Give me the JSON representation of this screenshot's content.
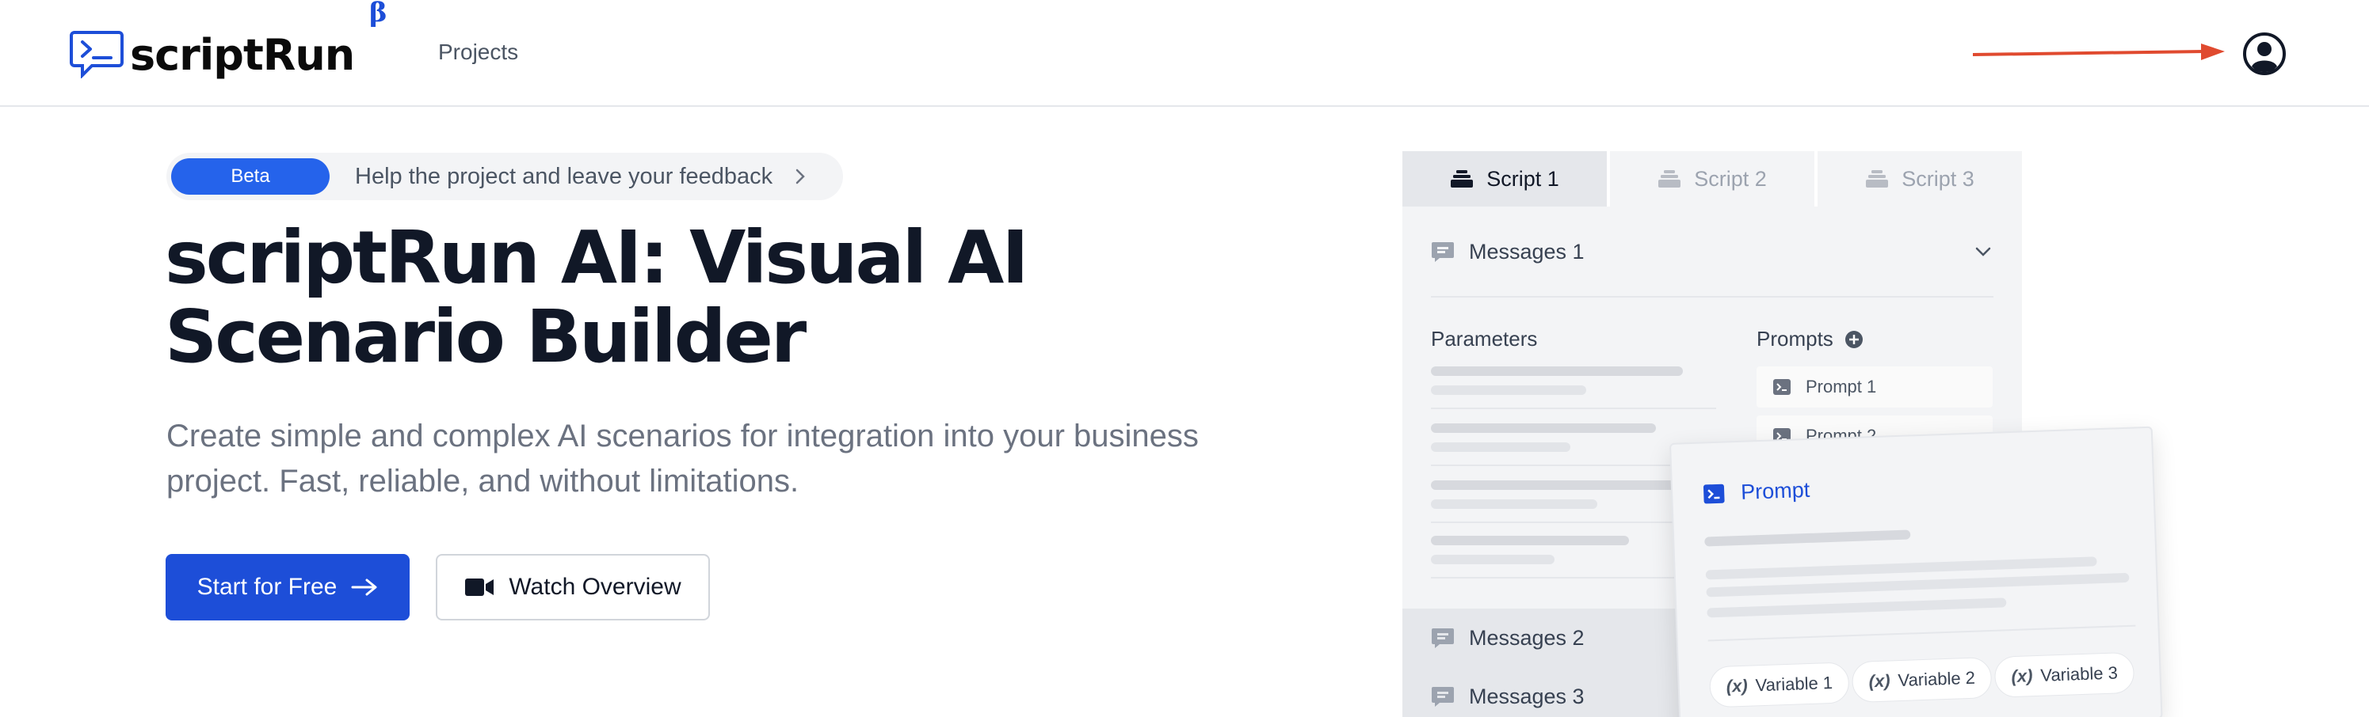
{
  "header": {
    "logo_text": "scriptRun",
    "logo_beta": "β",
    "nav": [
      {
        "label": "Projects",
        "icon": null
      }
    ],
    "account_icon": "user-circle-icon",
    "annotation_arrow_color": "#e04a2f"
  },
  "hero": {
    "badge_label": "Beta",
    "badge_text": "Help the project and leave your feedback",
    "title_line1": "scriptRun AI: Visual AI",
    "title_line2": "Scenario Builder",
    "subtitle_line1": "Create simple and complex AI scenarios for integration into your business",
    "subtitle_line2": "project. Fast, reliable, and without limitations.",
    "primary_button": "Start for Free",
    "secondary_button": "Watch Overview"
  },
  "mockup": {
    "tabs": [
      "Script 1",
      "Script 2",
      "Script 3"
    ],
    "active_tab": "Script 1",
    "messages": [
      "Messages 1",
      "Messages 2",
      "Messages 3"
    ],
    "parameters_label": "Parameters",
    "prompts_label": "Prompts",
    "prompt_items": [
      "Prompt 1",
      "Prompt 2"
    ],
    "card": {
      "title": "Prompt",
      "variables": [
        "Variable 1",
        "Variable 2",
        "Variable 3"
      ],
      "variable_prefix": "(x)"
    }
  },
  "colors": {
    "accent": "#1d4ed8",
    "beta_badge": "#2563eb",
    "text_dark": "#111827",
    "text_muted": "#6b7280"
  }
}
